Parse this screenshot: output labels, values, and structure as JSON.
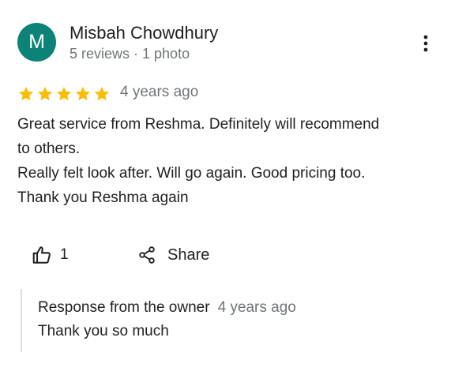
{
  "reviewer": {
    "initial": "M",
    "name": "Misbah Chowdhury",
    "meta": "5 reviews · 1 photo",
    "avatar_color": "#0d8277"
  },
  "more_icon": "vertical-ellipsis-icon",
  "rating": {
    "stars": 5,
    "max": 5,
    "star_color": "#fbbc04",
    "icon": "star-icon"
  },
  "review": {
    "date": "4 years ago",
    "lines": [
      "Great service from Reshma. Definitely will recommend",
      "to others.",
      "Really felt look after. Will go again. Good pricing too.",
      "Thank you Reshma again"
    ]
  },
  "actions": {
    "like_icon": "thumbs-up-icon",
    "like_count": "1",
    "share_icon": "share-icon",
    "share_label": "Share"
  },
  "owner_response": {
    "title": "Response from the owner",
    "date": "4 years ago",
    "text": "Thank you so much"
  }
}
